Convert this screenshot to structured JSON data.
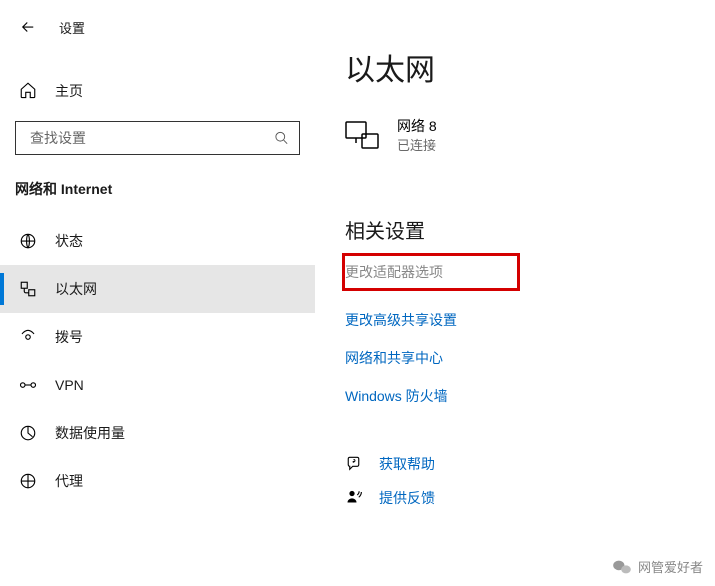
{
  "header": {
    "title": "设置"
  },
  "sidebar": {
    "home_label": "主页",
    "search_placeholder": "查找设置",
    "section_label": "网络和 Internet",
    "items": [
      {
        "label": "状态",
        "icon": "status-icon",
        "selected": false
      },
      {
        "label": "以太网",
        "icon": "ethernet-icon",
        "selected": true
      },
      {
        "label": "拨号",
        "icon": "dialup-icon",
        "selected": false
      },
      {
        "label": "VPN",
        "icon": "vpn-icon",
        "selected": false
      },
      {
        "label": "数据使用量",
        "icon": "data-usage-icon",
        "selected": false
      },
      {
        "label": "代理",
        "icon": "proxy-icon",
        "selected": false
      }
    ]
  },
  "main": {
    "title": "以太网",
    "network": {
      "name": "网络 8",
      "state": "已连接"
    },
    "related": {
      "title": "相关设置",
      "links": [
        {
          "label": "更改适配器选项",
          "highlighted": true
        },
        {
          "label": "更改高级共享设置",
          "highlighted": false
        },
        {
          "label": "网络和共享中心",
          "highlighted": false
        },
        {
          "label": "Windows 防火墙",
          "highlighted": false
        }
      ]
    },
    "help": {
      "get_help": "获取帮助",
      "feedback": "提供反馈"
    }
  },
  "watermark": "网管爱好者"
}
